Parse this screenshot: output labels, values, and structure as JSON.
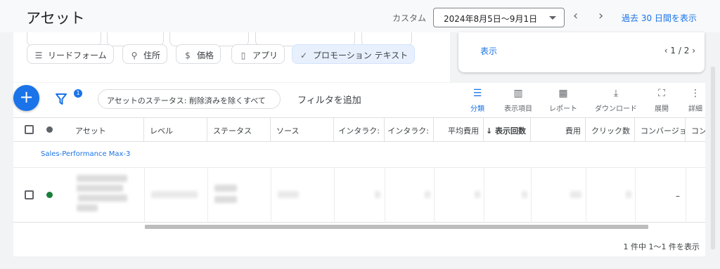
{
  "header": {
    "title": "アセット",
    "date_label": "カスタム",
    "date_range": "2024年8月5日～9月1日",
    "prev_arrow": "‹",
    "next_arrow": "›",
    "show_last_30": "過去 30 日間を表示"
  },
  "chips": [
    {
      "label": "リードフォーム",
      "icon": "form-icon"
    },
    {
      "label": "住所",
      "icon": "location-pin-icon"
    },
    {
      "label": "価格",
      "icon": "price-icon"
    },
    {
      "label": "アプリ",
      "icon": "phone-icon"
    },
    {
      "label": "プロモーション テキスト",
      "icon": "check-icon",
      "selected": true
    }
  ],
  "summary": {
    "show_label": "表示",
    "pager": "1 / 2"
  },
  "toolbar": {
    "add_label": "+",
    "filter_badge": "1",
    "status_filter": "アセットのステータス: 削除済みを除くすべて",
    "add_filter": "フィルタを追加",
    "tools": [
      {
        "label": "分類",
        "icon": "segment-icon",
        "active": true
      },
      {
        "label": "表示項目",
        "icon": "columns-icon"
      },
      {
        "label": "レポート",
        "icon": "report-icon"
      },
      {
        "label": "ダウンロード",
        "icon": "download-icon"
      },
      {
        "label": "展開",
        "icon": "fullscreen-icon"
      },
      {
        "label": "詳細",
        "icon": "more-vert-icon"
      }
    ]
  },
  "table": {
    "columns": [
      "アセット",
      "レベル",
      "ステータス",
      "ソース",
      "インタラク:",
      "インタラク:",
      "平均費用",
      "↓ 表示回数",
      "費用",
      "クリック数",
      "コンバージョ",
      "コンバー"
    ],
    "group_label": "Sales-Performance Max-3",
    "row_dash": "–",
    "status_color": "#188038"
  },
  "footer": {
    "count": "1 件中 1～1 件を表示"
  },
  "colors": {
    "accent": "#1a73e8",
    "status_green": "#188038"
  }
}
